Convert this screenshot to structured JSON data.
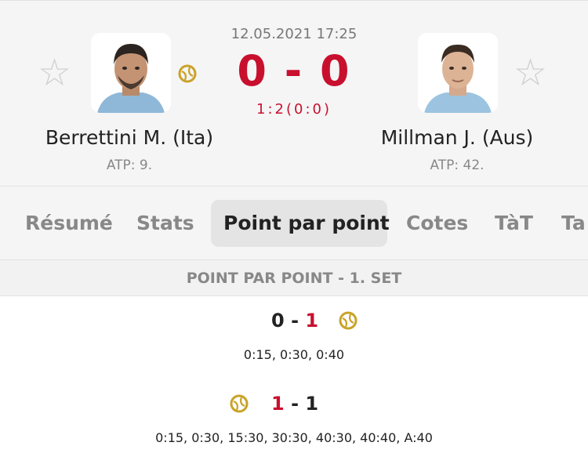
{
  "match": {
    "datetime": "12.05.2021 17:25",
    "score": "0 - 0",
    "set_info": "1:2(0:0)"
  },
  "players": {
    "home": {
      "name": "Berrettini M. (Ita)",
      "rank": "ATP: 9.",
      "favorite_icon": "star-icon"
    },
    "away": {
      "name": "Millman J. (Aus)",
      "rank": "ATP: 42.",
      "favorite_icon": "star-icon"
    }
  },
  "tabs": [
    {
      "label": "Résumé",
      "active": false
    },
    {
      "label": "Stats",
      "active": false
    },
    {
      "label": "Point par point",
      "active": true
    },
    {
      "label": "Cotes",
      "active": false
    },
    {
      "label": "TàT",
      "active": false
    },
    {
      "label": "Ta",
      "active": false
    }
  ],
  "section_title": "POINT PAR POINT - 1. SET",
  "games": [
    {
      "home": "0",
      "sep": "-",
      "away": "1",
      "server": "away",
      "points": "0:15, 0:30, 0:40"
    },
    {
      "home": "1",
      "sep": "-",
      "away": "1",
      "server": "home",
      "points": "0:15, 0:30, 15:30, 30:30, 40:30, 40:40, A:40"
    }
  ],
  "colors": {
    "accent_red": "#c8102e",
    "serve_ball": "#c9a227",
    "muted": "#888888"
  }
}
